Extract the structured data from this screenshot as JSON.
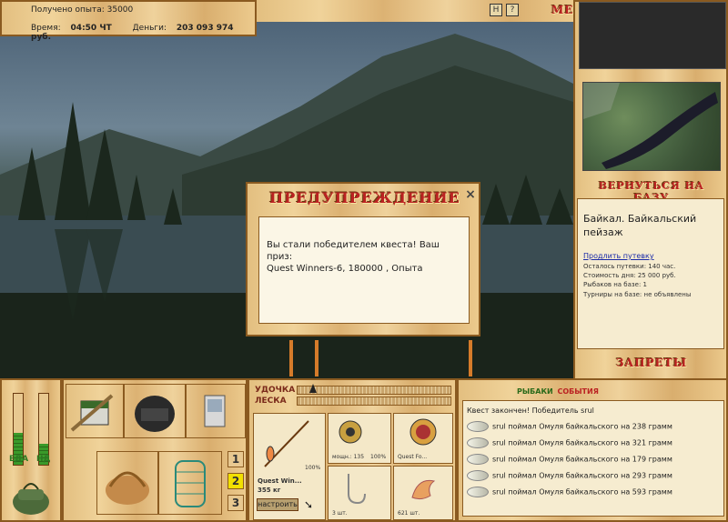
{
  "stats": {
    "experience_label": "Получено опыта:",
    "experience_value": "35000",
    "time_label": "Время:",
    "time_value": "04:50 ЧТ",
    "money_label": "Деньги:",
    "money_value": "203 093 974 руб."
  },
  "topbar": {
    "btn_h": "H",
    "btn_q": "?",
    "menu_label": "МЕНЮ"
  },
  "modal": {
    "title": "ПРЕДУПРЕЖДЕНИЕ",
    "close_glyph": "×",
    "message_line1": "Вы стали победителем квеста! Ваш приз:",
    "message_line2": "Quest Winners-6, 180000 , Опыта"
  },
  "right": {
    "return_label": "ВЕРНУТЬСЯ НА БАЗУ",
    "location": "Байкал. Байкальский пейзаж",
    "extend_link": "Продлить путевку",
    "trip_left": "Осталось путевки: 140 час.",
    "day_cost": "Стоимость дня: 25 000 руб.",
    "anglers": "Рыбаков на базе: 1",
    "tournaments": "Турниры на базе: не объявлены",
    "bans_label": "ЗАПРЕТЫ"
  },
  "gauges": {
    "food_label": "ЕДА",
    "drink_label": "НД",
    "food_level": 0.45,
    "drink_level": 0.3
  },
  "items": {
    "slot_numbers": [
      "1",
      "2",
      "3"
    ],
    "active_slot": "2"
  },
  "tackle": {
    "rod_label": "УДОЧКА",
    "line_label": "ЛЕСКА",
    "rod_name": "Quest Win...",
    "rod_weight": "355 кг",
    "rod_condition": "100%",
    "reel_power": "мощн.: 135",
    "reel_condition": "100%",
    "bait_name": "Quest Fo...",
    "hook_count": "3 шт.",
    "bait_count": "621 шт.",
    "setup_label": "настроить"
  },
  "events": {
    "title_part1": "РЫБАКИ",
    "title_part2": "СОБЫТИЯ",
    "quest_line": "Квест закончен! Победитель srul",
    "catches": [
      "srul поймал Омуля байкальского на 238 грамм",
      "srul поймал Омуля байкальского на 321 грамм",
      "srul поймал Омуля байкальского на 179 грамм",
      "srul поймал Омуля байкальского на 293 грамм",
      "srul поймал Омуля байкальского на 593 грамм"
    ]
  },
  "colors": {
    "wood": "#e3bf80",
    "border": "#8a5a20",
    "title_red": "#b22222",
    "gauge_green": "#3a9a2a"
  }
}
